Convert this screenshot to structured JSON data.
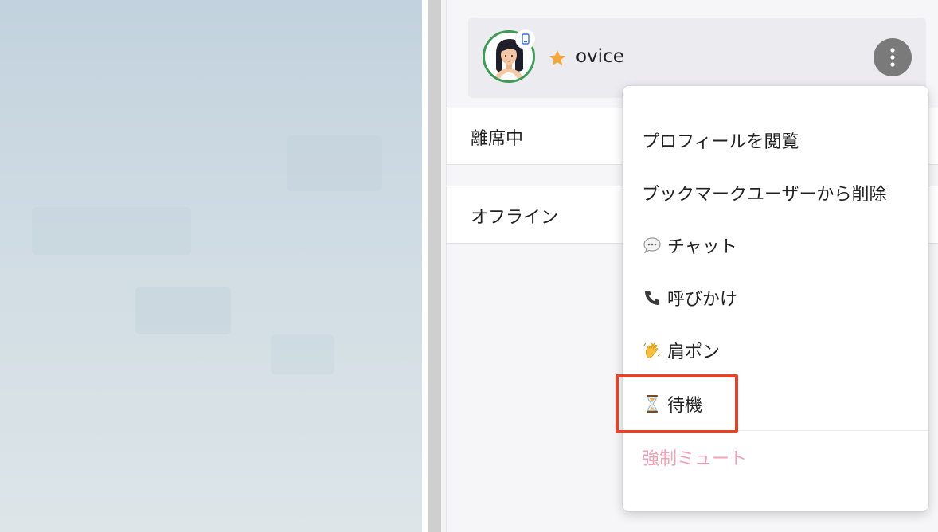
{
  "user": {
    "name": "ovice",
    "avatar_icon": "woman-avatar-icon",
    "device_icon": "mobile-device-icon",
    "favorite_icon": "star-icon",
    "more_icon": "vertical-dots-icon"
  },
  "sections": [
    {
      "label": "離席中"
    },
    {
      "label": "オフライン"
    }
  ],
  "menu": {
    "items": [
      {
        "label": "プロフィールを閲覧",
        "icon": null
      },
      {
        "label": "ブックマークユーザーから削除",
        "icon": null
      },
      {
        "label": "チャット",
        "icon": "speech-bubble-icon"
      },
      {
        "label": "呼びかけ",
        "icon": "phone-icon"
      },
      {
        "label": "肩ポン",
        "icon": "waving-hand-icon"
      },
      {
        "label": "待機",
        "icon": "hourglass-icon"
      },
      {
        "label": "強制ミュート",
        "icon": null,
        "disabled": true
      }
    ],
    "highlighted_item": "待機"
  },
  "colors": {
    "avatar_ring": "#3d9a57",
    "star": "#f2a93b",
    "more_button": "#7a7a7a",
    "highlight": "#e0442b",
    "disabled_text": "#f0a3b6"
  }
}
